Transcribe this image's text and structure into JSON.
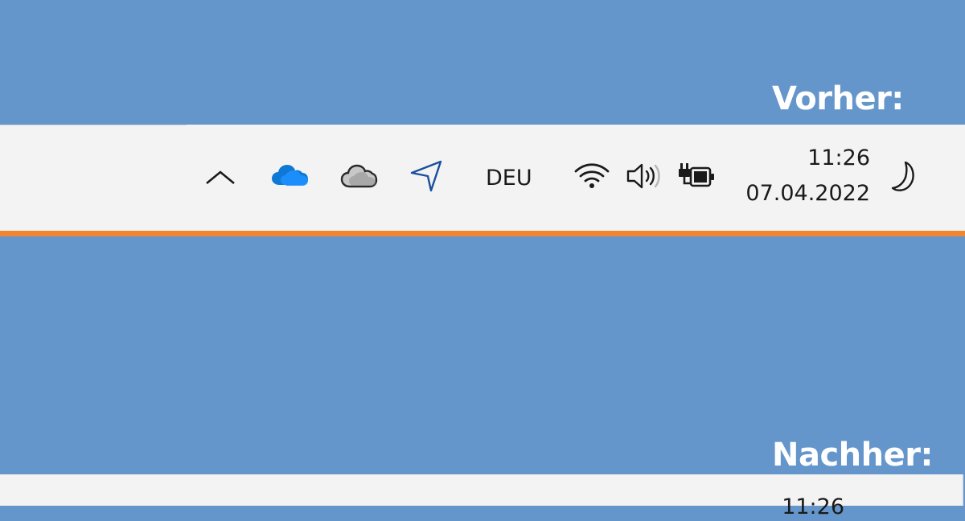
{
  "labels": {
    "before": "Vorher:",
    "after": "Nachher:"
  },
  "tray": {
    "language": "DEU",
    "time": "11:26",
    "date": "07.04.2022",
    "icons": [
      "chevron-up-icon",
      "onedrive-icon",
      "cloud-icon",
      "location-icon",
      "wifi-icon",
      "speaker-icon",
      "battery-charging-icon",
      "moon-icon"
    ]
  },
  "after_tray": {
    "time": "11:26"
  },
  "colors": {
    "background": "#6496cc",
    "taskbar": "#f3f3f3",
    "accent_line": "#f0862f",
    "onedrive": "#0f78d4",
    "location": "#1a4f9c"
  }
}
